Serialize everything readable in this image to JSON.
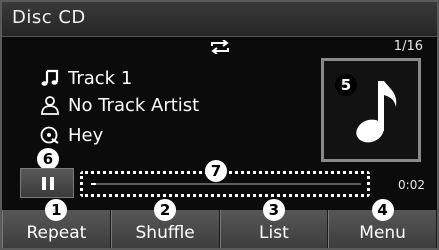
{
  "header": {
    "title": "Disc CD",
    "track_counter": "1/16"
  },
  "track": {
    "title": "Track 1",
    "artist": "No Track Artist",
    "album": "Hey"
  },
  "playback": {
    "elapsed": "0:02",
    "progress": 0.02,
    "state": "playing"
  },
  "callouts": {
    "repeat": "1",
    "shuffle": "2",
    "list": "3",
    "menu": "4",
    "album_art": "5",
    "pause": "6",
    "progress": "7"
  },
  "menu": {
    "items": [
      {
        "label": "Repeat"
      },
      {
        "label": "Shuffle"
      },
      {
        "label": "List"
      },
      {
        "label": "Menu"
      }
    ]
  },
  "icons": {
    "repeat_indicator": "repeat-icon",
    "track": "music-note-icon",
    "artist": "person-icon",
    "album": "disc-icon",
    "album_art": "music-note-icon",
    "pause": "pause-icon"
  }
}
